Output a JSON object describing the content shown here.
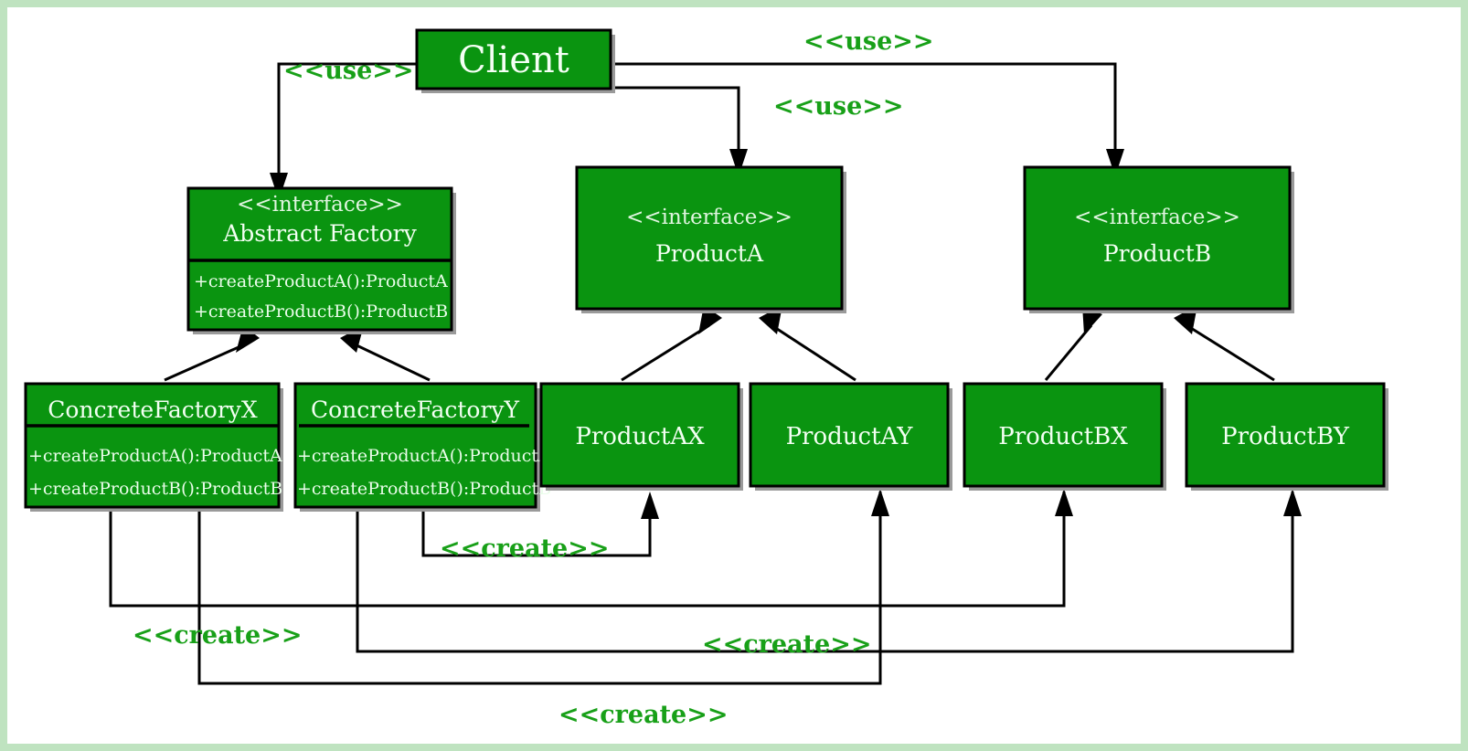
{
  "diagram": {
    "kind": "uml-class-diagram",
    "title_pattern": "Abstract Factory",
    "colors": {
      "page_border": "#bfe3c0",
      "canvas": "#ffffff",
      "box_fill": "#0a9410",
      "box_stroke": "#000000",
      "box_text": "#f2fff2",
      "relation_label": "#18a018",
      "edge": "#000000"
    },
    "stereotype_interface": "<<interface>>",
    "classes": {
      "client": {
        "name": "Client",
        "stereotype": "",
        "members": []
      },
      "abstract_factory": {
        "name": "Abstract Factory",
        "stereotype": "<<interface>>",
        "members": [
          "+createProductA():ProductA",
          "+createProductB():ProductB"
        ]
      },
      "product_a": {
        "name": "ProductA",
        "stereotype": "<<interface>>",
        "members": []
      },
      "product_b": {
        "name": "ProductB",
        "stereotype": "<<interface>>",
        "members": []
      },
      "concrete_factory_x": {
        "name": "ConcreteFactoryX",
        "stereotype": "",
        "members": [
          "+createProductA():ProductA",
          "+createProductB():ProductB"
        ]
      },
      "concrete_factory_y": {
        "name": "ConcreteFactoryY",
        "stereotype": "",
        "members": [
          "+createProductA():ProductA",
          "+createProductB():ProductB"
        ]
      },
      "product_ax": {
        "name": "ProductAX",
        "stereotype": "",
        "members": []
      },
      "product_ay": {
        "name": "ProductAY",
        "stereotype": "",
        "members": []
      },
      "product_bx": {
        "name": "ProductBX",
        "stereotype": "",
        "members": []
      },
      "product_by": {
        "name": "ProductBY",
        "stereotype": "",
        "members": []
      }
    },
    "relations": {
      "use_label": "<<use>>",
      "create_label": "<<create>>",
      "labels": {
        "use_client_to_abstract_factory": "<<use>>",
        "use_client_to_product_b": "<<use>>",
        "use_client_to_product_a": "<<use>>",
        "create_y_to_ax": "<<create>>",
        "create_x_to_ay": "<<create>>",
        "create_x_to_bx": "<<create>>",
        "create_y_to_by": "<<create>>"
      },
      "generalizations": [
        {
          "from": "ConcreteFactoryX",
          "to": "Abstract Factory"
        },
        {
          "from": "ConcreteFactoryY",
          "to": "Abstract Factory"
        },
        {
          "from": "ProductAX",
          "to": "ProductA"
        },
        {
          "from": "ProductAY",
          "to": "ProductA"
        },
        {
          "from": "ProductBX",
          "to": "ProductB"
        },
        {
          "from": "ProductBY",
          "to": "ProductB"
        }
      ],
      "dependencies": [
        {
          "from": "Client",
          "to": "Abstract Factory",
          "label": "<<use>>"
        },
        {
          "from": "Client",
          "to": "ProductA",
          "label": "<<use>>"
        },
        {
          "from": "Client",
          "to": "ProductB",
          "label": "<<use>>"
        },
        {
          "from": "ConcreteFactoryX",
          "to": "ProductAY",
          "label": "<<create>>"
        },
        {
          "from": "ConcreteFactoryX",
          "to": "ProductBX",
          "label": "<<create>>"
        },
        {
          "from": "ConcreteFactoryY",
          "to": "ProductAX",
          "label": "<<create>>"
        },
        {
          "from": "ConcreteFactoryY",
          "to": "ProductBY",
          "label": "<<create>>"
        }
      ]
    }
  }
}
